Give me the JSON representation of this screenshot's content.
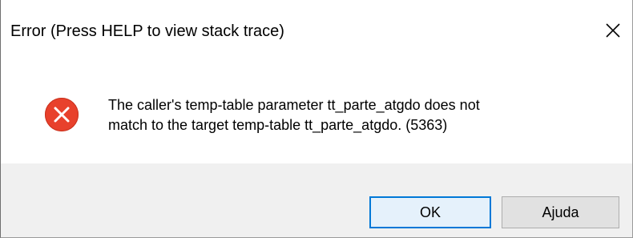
{
  "window": {
    "title": "Error (Press HELP to view stack trace)",
    "close_icon": "close-icon"
  },
  "message": {
    "icon": "error-circle-x-icon",
    "line1": "The caller's temp-table parameter tt_parte_atgdo does not",
    "line2": "match to the target temp-table tt_parte_atgdo. (5363)"
  },
  "buttons": {
    "ok_label": "OK",
    "help_label": "Ajuda"
  },
  "colors": {
    "error_red": "#e8412c",
    "focus_blue": "#0078d7",
    "footer_bg": "#f0f0f0"
  }
}
